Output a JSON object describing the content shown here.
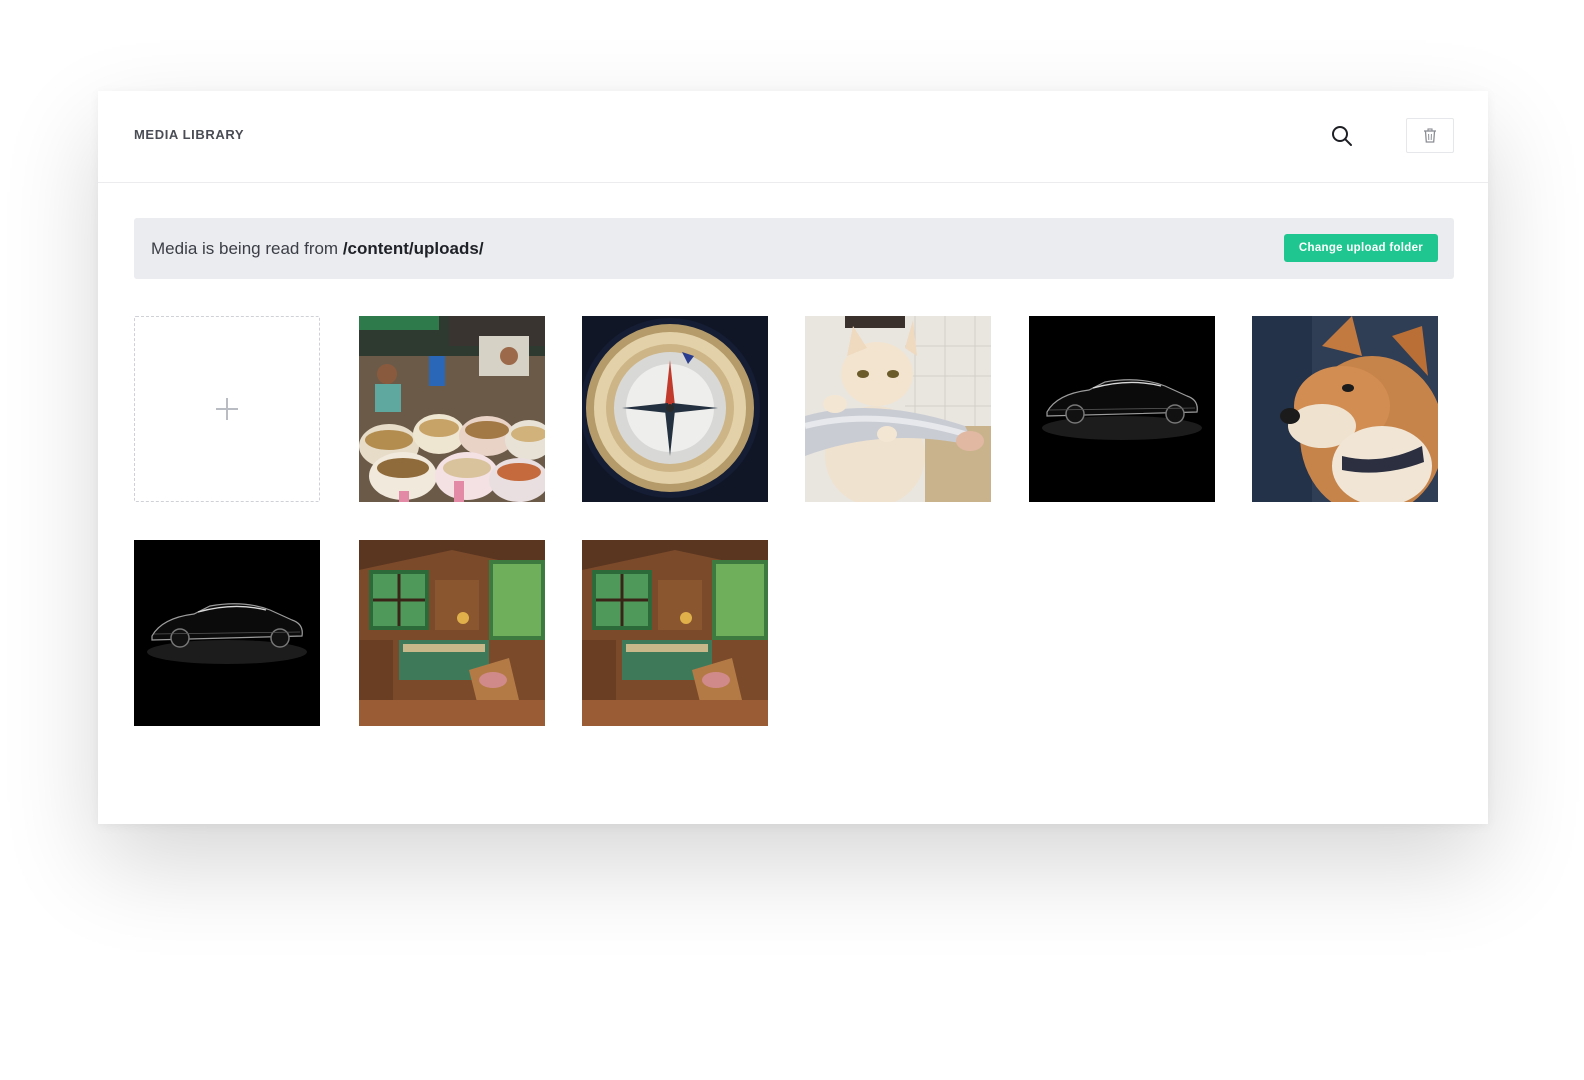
{
  "header": {
    "title": "MEDIA LIBRARY",
    "search_icon": "search-icon",
    "trash_icon": "trash-icon"
  },
  "notice": {
    "prefix": "Media is being read from ",
    "path": "/content/uploads/",
    "button_label": "Change upload folder"
  },
  "colors": {
    "accent": "#1fc68f",
    "notice_bg": "#ebecef"
  },
  "add_tile": {
    "icon": "plus-icon"
  },
  "media": [
    {
      "subject": "market-spices"
    },
    {
      "subject": "compass"
    },
    {
      "subject": "cat-biting-sleeve"
    },
    {
      "subject": "black-car"
    },
    {
      "subject": "shiba-dog"
    },
    {
      "subject": "black-car"
    },
    {
      "subject": "cabin-interior"
    },
    {
      "subject": "cabin-interior"
    }
  ]
}
